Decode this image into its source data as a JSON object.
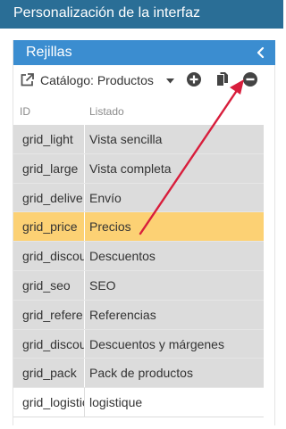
{
  "topbar": {
    "title": "Personalización de la interfaz"
  },
  "panel": {
    "title": "Rejillas",
    "collapse_icon": "chevron-left-icon"
  },
  "toolbar": {
    "catalog_label": "Catálogo: Productos",
    "icons": [
      "external-link-icon",
      "caret-down-icon",
      "add-circle-icon",
      "copy-icon",
      "remove-circle-icon"
    ]
  },
  "grid": {
    "columns": [
      "ID",
      "Listado"
    ],
    "rows": [
      {
        "id": "grid_light",
        "name": "Vista sencilla",
        "state": "normal"
      },
      {
        "id": "grid_large",
        "name": "Vista completa",
        "state": "normal"
      },
      {
        "id": "grid_delive",
        "name": "Envío",
        "state": "normal"
      },
      {
        "id": "grid_price",
        "name": "Precios",
        "state": "selected"
      },
      {
        "id": "grid_discou",
        "name": "Descuentos",
        "state": "normal"
      },
      {
        "id": "grid_seo",
        "name": "SEO",
        "state": "normal"
      },
      {
        "id": "grid_refere",
        "name": "Referencias",
        "state": "normal"
      },
      {
        "id": "grid_discou",
        "name": "Descuentos y márgenes",
        "state": "normal"
      },
      {
        "id": "grid_pack",
        "name": "Pack de productos",
        "state": "normal"
      },
      {
        "id": "grid_logistic",
        "name": "logistique",
        "state": "plain"
      }
    ]
  },
  "colors": {
    "topbar": "#2a6e96",
    "panel_header": "#3b8dd0",
    "row": "#dcdcdc",
    "selected_row": "#fcd174",
    "annotation_arrow": "#d81e3c"
  }
}
